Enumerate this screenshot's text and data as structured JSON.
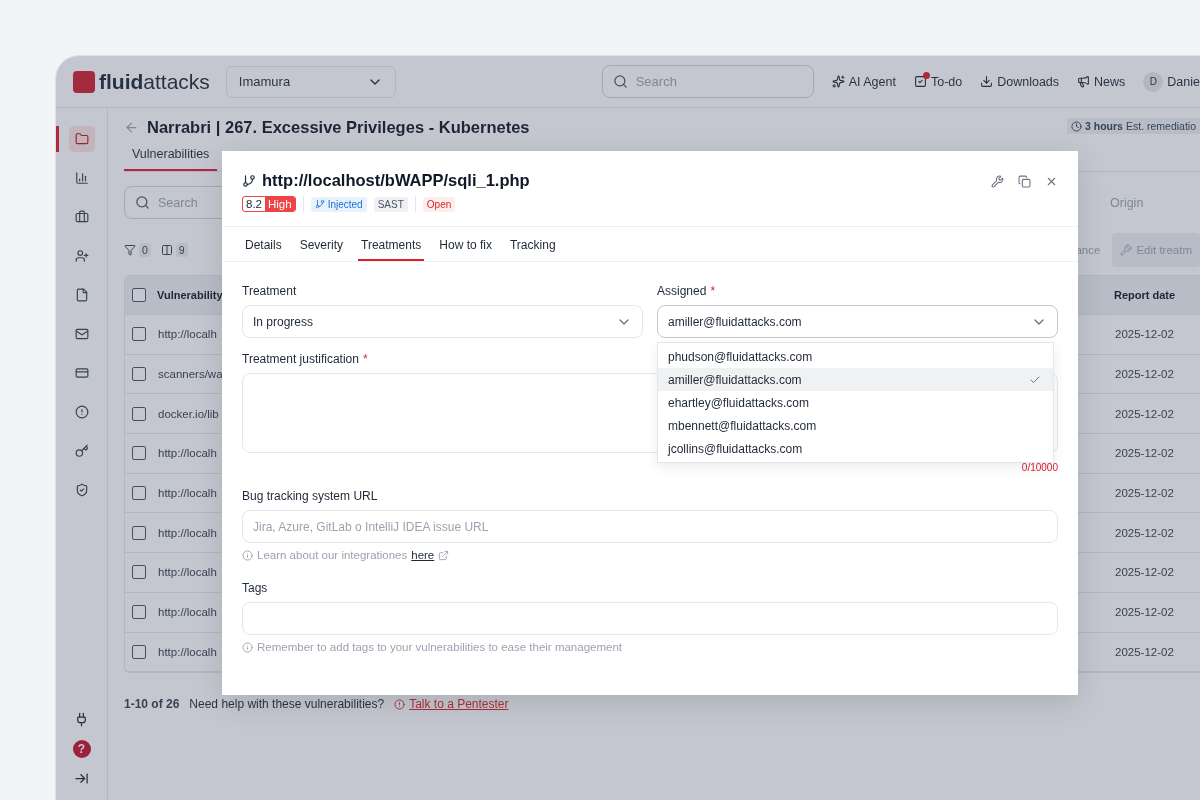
{
  "topbar": {
    "logo": {
      "bold": "fluid",
      "light": "attacks"
    },
    "organization": "Imamura",
    "search": {
      "placeholder": "Search"
    },
    "nav": [
      {
        "kind": "ai",
        "label": "AI Agent",
        "alert": false
      },
      {
        "kind": "todo",
        "label": "To-do",
        "alert": true
      },
      {
        "kind": "downloads",
        "label": "Downloads",
        "alert": false
      },
      {
        "kind": "news",
        "label": "News",
        "alert": false
      }
    ],
    "user": {
      "initial": "D",
      "name": "Danie"
    }
  },
  "sidebar": {
    "items": [
      {
        "kind": "folder",
        "selected": true
      },
      {
        "kind": "chart",
        "selected": false
      },
      {
        "kind": "briefcase",
        "selected": false
      },
      {
        "kind": "user-plus",
        "selected": false
      },
      {
        "kind": "file",
        "selected": false
      },
      {
        "kind": "mail",
        "selected": false
      },
      {
        "kind": "card",
        "selected": false
      },
      {
        "kind": "alert",
        "selected": false
      },
      {
        "kind": "key",
        "selected": false
      },
      {
        "kind": "shield",
        "selected": false
      }
    ],
    "bottom": {
      "help": "?"
    }
  },
  "page": {
    "title": "Narrabri | 267. Excessive Privileges - Kubernetes",
    "remediation": {
      "amount": "3 hours",
      "label": "Est. remediatio"
    },
    "tabs": [
      {
        "label": "Vulnerabilities",
        "selected": true
      }
    ],
    "search": {
      "placeholder": "Search"
    },
    "origin": {
      "placeholder": "Origin"
    },
    "filters": [
      {
        "kind": "filter",
        "count": "0"
      },
      {
        "kind": "columns",
        "count": "9"
      }
    ],
    "actions": [
      {
        "kind": "plain",
        "label": "ance"
      },
      {
        "kind": "edit",
        "label": "Edit treatm"
      }
    ],
    "table": {
      "columns": [
        "Vulnerability",
        "Report date"
      ],
      "all_checked": false,
      "rows": [
        {
          "vulnerability": "http://localh",
          "report_date": "2025-12-02",
          "checked": false
        },
        {
          "vulnerability": "scanners/wa",
          "report_date": "2025-12-02",
          "checked": false
        },
        {
          "vulnerability": "docker.io/lib",
          "report_date": "2025-12-02",
          "checked": false
        },
        {
          "vulnerability": "http://localh",
          "report_date": "2025-12-02",
          "checked": false
        },
        {
          "vulnerability": "http://localh",
          "report_date": "2025-12-02",
          "checked": false
        },
        {
          "vulnerability": "http://localh",
          "report_date": "2025-12-02",
          "checked": false
        },
        {
          "vulnerability": "http://localh",
          "report_date": "2025-12-02",
          "checked": false
        },
        {
          "vulnerability": "http://localh",
          "report_date": "2025-12-02",
          "checked": false
        },
        {
          "vulnerability": "http://localh",
          "report_date": "2025-12-02",
          "checked": false
        }
      ]
    },
    "footer": {
      "range": "1-10 of 26",
      "help": "Need help with these vulnerabilities?",
      "link": "Talk to a Pentester"
    }
  },
  "modal": {
    "title": "http://localhost/bWAPP/sqli_1.php",
    "score": "8.2",
    "severity": "High",
    "tags": [
      {
        "kind": "technique",
        "label": "Injected"
      },
      {
        "kind": "neutral",
        "label": "SAST"
      }
    ],
    "status": "Open",
    "tabs": [
      {
        "label": "Details",
        "selected": false
      },
      {
        "label": "Severity",
        "selected": false
      },
      {
        "label": "Treatments",
        "selected": true
      },
      {
        "label": "How to fix",
        "selected": false
      },
      {
        "label": "Tracking",
        "selected": false
      }
    ],
    "treatment": {
      "label": "Treatment",
      "value": "In progress"
    },
    "assigned": {
      "label": "Assigned",
      "required_mark": "*",
      "value": "amiller@fluidattacks.com",
      "expanded": true,
      "options": [
        {
          "label": "phudson@fluidattacks.com",
          "selected": false
        },
        {
          "label": "amiller@fluidattacks.com",
          "selected": true
        },
        {
          "label": "ehartley@fluidattacks.com",
          "selected": false
        },
        {
          "label": "mbennett@fluidattacks.com",
          "selected": false
        },
        {
          "label": "jcollins@fluidattacks.com",
          "selected": false
        }
      ]
    },
    "justification": {
      "label": "Treatment justification",
      "required_mark": "*",
      "counter": "0/10000"
    },
    "bug_url": {
      "label": "Bug tracking system URL",
      "placeholder": "Jira, Azure, GitLab o IntelliJ IDEA issue URL",
      "hint": "Learn about our integrationes",
      "link": "here"
    },
    "tags_field": {
      "label": "Tags",
      "hint": "Remember to add tags to your vulnerabilities to ease their management"
    }
  }
}
